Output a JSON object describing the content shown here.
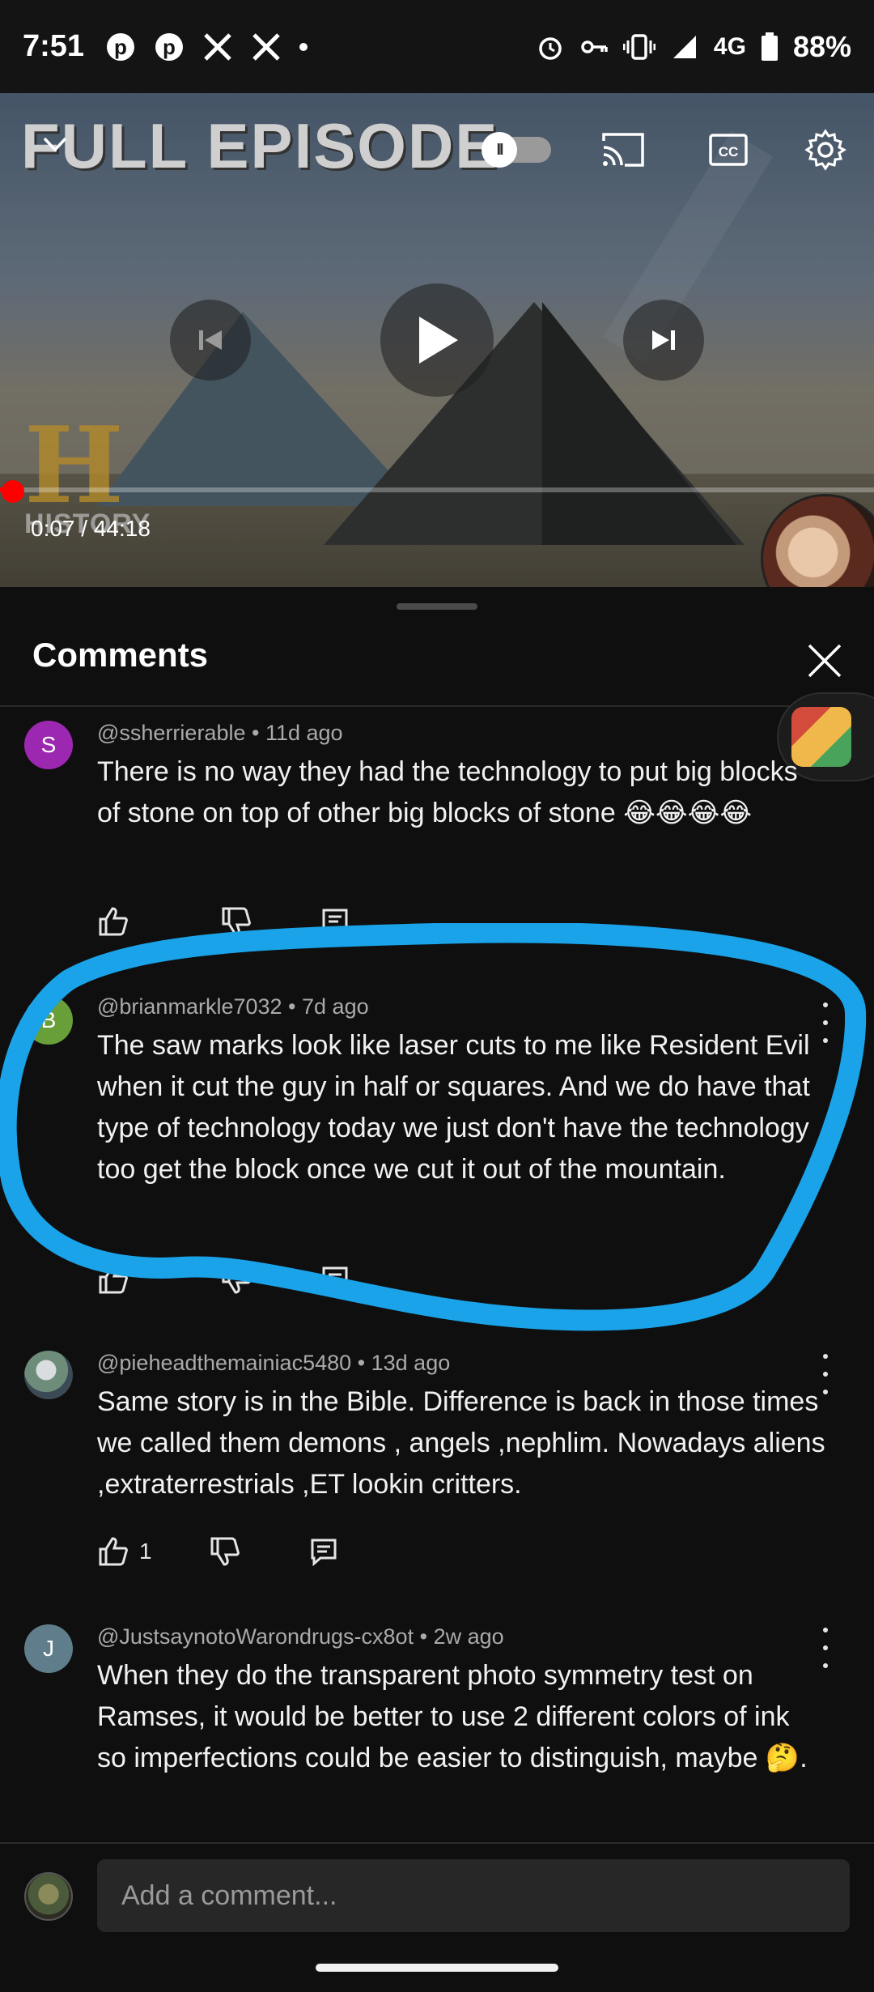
{
  "status_bar": {
    "time": "7:51",
    "left_icons": [
      "pinterest-icon",
      "pinterest-icon",
      "x-icon",
      "x-icon"
    ],
    "right_icons": [
      "alarm-icon",
      "vpn-key-icon",
      "vibrate-icon",
      "signal-icon"
    ],
    "network": "4G",
    "battery": "88%"
  },
  "player": {
    "title_overlay": "FULL EPISODE",
    "time_display": "0:07 / 44:18",
    "progress_fraction": 0.0026,
    "watermark": "HISTORY",
    "autoplay_on": false
  },
  "comments": {
    "title": "Comments",
    "items": [
      {
        "avatar_letter": "S",
        "avatar_color": "#9c27b0",
        "author": "@ssherrierable",
        "age": "11d ago",
        "text": "There is no way they had the technology to put big blocks of stone on top of other big blocks of stone 😂😂😂😂",
        "likes": ""
      },
      {
        "avatar_letter": "B",
        "avatar_color": "#689f38",
        "author": "@brianmarkle7032",
        "age": "7d ago",
        "text": "The saw marks look like laser cuts to me like Resident Evil when it cut the guy in half or squares. And we do have that type of technology today we just don't have the technology too get the block once we cut it out of the mountain.",
        "likes": ""
      },
      {
        "avatar_letter": "",
        "avatar_color": "#4c6a7a",
        "author": "@pieheadthemainiac5480",
        "age": "13d ago",
        "text": "Same story is in the Bible. Difference is back in those times we called them demons , angels ,nephlim. Nowadays aliens ,extraterrestrials ,ET lookin critters.",
        "likes": "1"
      },
      {
        "avatar_letter": "J",
        "avatar_color": "#607d8b",
        "author": "@JustsaynotoWarondrugs-cx8ot",
        "age": "2w ago",
        "text": "When they do the transparent photo symmetry test on Ramses, it would be better to use 2 different colors of ink so imperfections could be easier to distinguish, maybe 🤔.",
        "likes": ""
      }
    ],
    "separator": "•",
    "add_placeholder": "Add a comment...",
    "highlight_color": "#1aa3e8"
  }
}
